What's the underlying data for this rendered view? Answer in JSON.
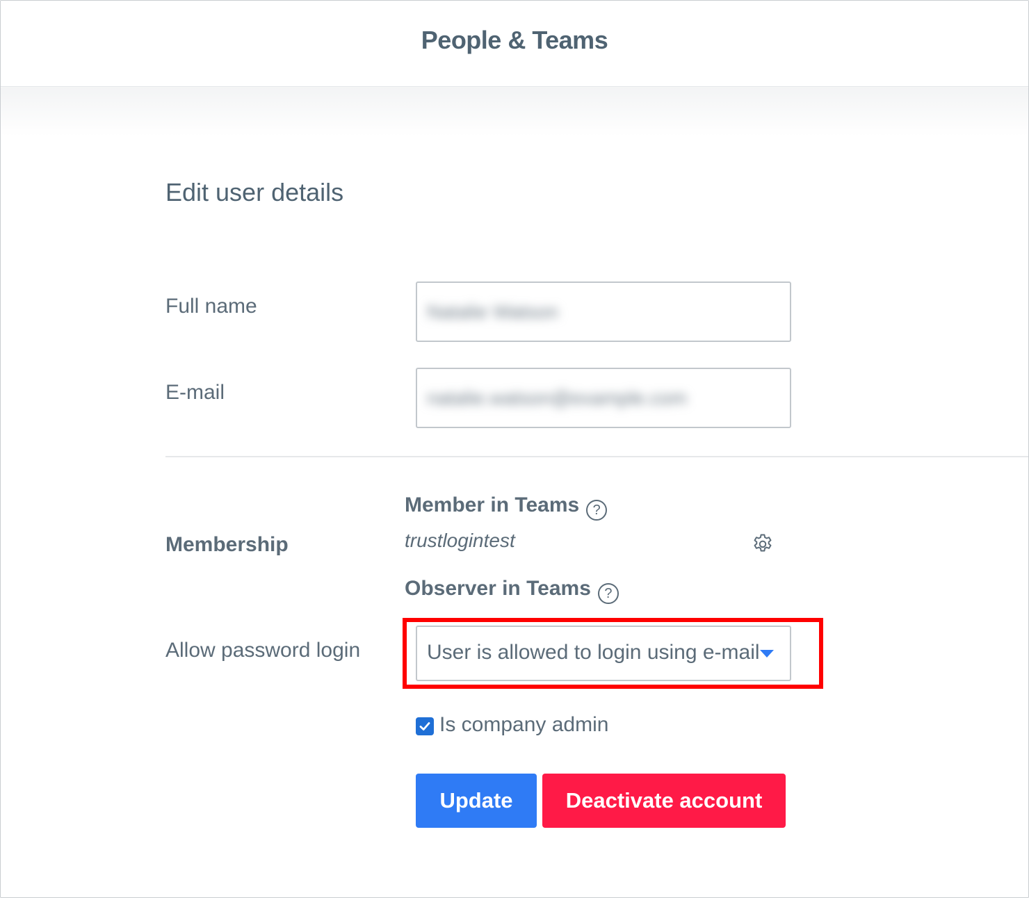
{
  "header": {
    "title": "People & Teams"
  },
  "page": {
    "heading": "Edit user details"
  },
  "form": {
    "full_name": {
      "label": "Full name",
      "value": "Natalie Watson"
    },
    "email": {
      "label": "E-mail",
      "value": "natalie.watson@example.com"
    },
    "membership": {
      "label": "Membership",
      "member_in_teams_title": "Member in Teams",
      "member_teams": [
        "trustlogintest"
      ],
      "observer_in_teams_title": "Observer in Teams"
    },
    "password_login": {
      "label": "Allow password login",
      "selected": "User is allowed to login using e-mail"
    },
    "company_admin": {
      "label": "Is company admin",
      "checked": true
    },
    "buttons": {
      "update": "Update",
      "deactivate": "Deactivate account"
    }
  },
  "icons": {
    "help": "help-circle-icon",
    "settings": "gear-icon",
    "dropdown": "caret-down-icon",
    "checkmark": "check-icon"
  },
  "colors": {
    "primary": "#2f7bf5",
    "danger": "#ff1a47",
    "highlight": "#ff0000",
    "text": "#5b6b78"
  }
}
